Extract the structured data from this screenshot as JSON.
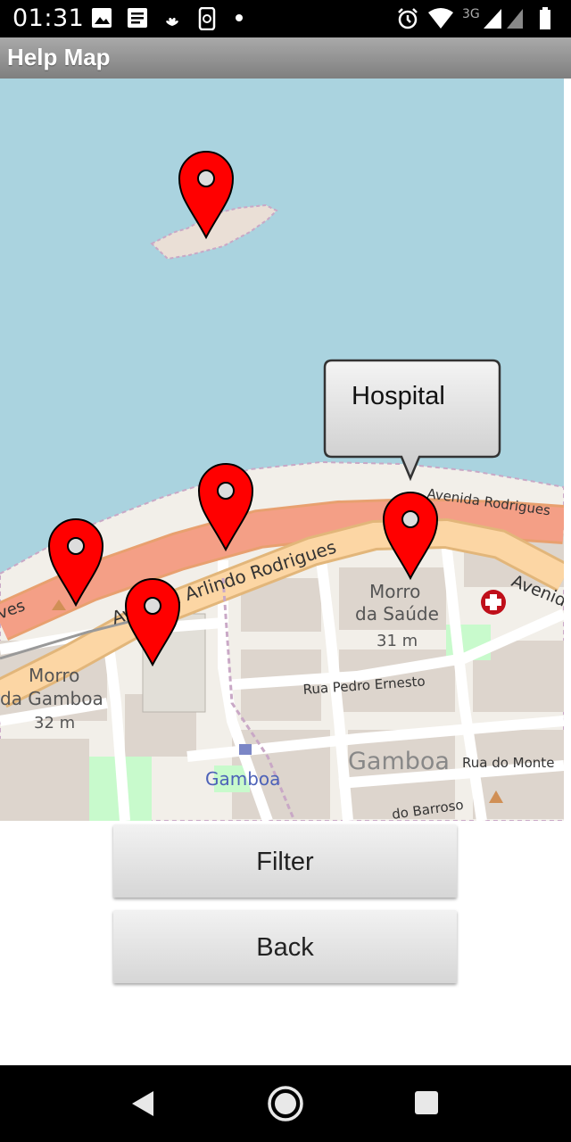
{
  "status_bar": {
    "time": "01:31",
    "network_label": "3G",
    "left_icons": [
      "image-icon",
      "news-icon",
      "santander-icon",
      "phone-sync-icon",
      "dot-icon"
    ],
    "right_icons": [
      "alarm-icon",
      "wifi-icon",
      "signal-icon",
      "battery-icon"
    ]
  },
  "app_bar": {
    "title": "Help Map"
  },
  "map": {
    "popup_text": "Hospital",
    "labels": {
      "avenida_rodrigues": "Avenida Rodrigues",
      "arlindo": "Avenida Arlindo Rodrigues",
      "aves": "ves",
      "avenida_right": "Avenid",
      "morro_saude": "Morro",
      "morro_saude_2": "da Saúde",
      "morro_saude_alt": "31 m",
      "morro_gamboa": "Morro",
      "morro_gamboa_2": "da Gamboa",
      "morro_gamboa_alt": "32 m",
      "rua_pedro": "Rua Pedro Ernesto",
      "gamboa_area": "Gamboa",
      "rua_monte": "Rua do Monte",
      "gamboa_station": "Gamboa",
      "rua_barroso": "do Barroso"
    },
    "markers": [
      "marker-island",
      "marker-shore",
      "marker-hospital",
      "marker-west",
      "marker-gamboa"
    ],
    "colors": {
      "water": "#aad3df",
      "land": "#f2efe9",
      "marker": "#ff0000",
      "motorway": "#f49f86",
      "primary": "#fcd6a4"
    }
  },
  "buttons": {
    "filter": "Filter",
    "back": "Back"
  },
  "nav_bar": {
    "icons": [
      "back-icon",
      "home-icon",
      "recents-icon"
    ]
  }
}
